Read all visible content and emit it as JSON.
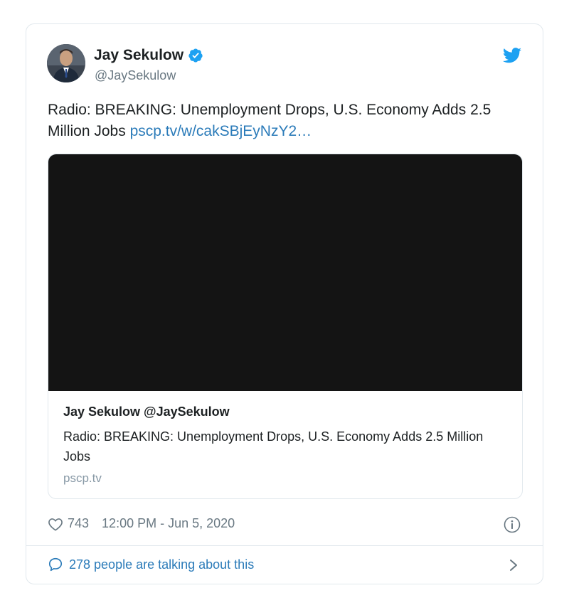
{
  "tweet": {
    "author_name": "Jay Sekulow",
    "author_handle": "@JaySekulow",
    "text": "Radio: BREAKING: Unemployment Drops, U.S. Economy Adds 2.5 Million Jobs",
    "link_text": "pscp.tv/w/cakSBjEyNzY2…",
    "card": {
      "title": "Jay Sekulow @JaySekulow",
      "description": "Radio: BREAKING: Unemployment Drops, U.S. Economy Adds 2.5 Million Jobs",
      "domain": "pscp.tv"
    },
    "likes": "743",
    "timestamp": "12:00 PM - Jun 5, 2020",
    "talking": "278 people are talking about this"
  },
  "icons": {
    "avatar": "avatar",
    "verified": "verified-badge-icon",
    "brand": "twitter-bird-icon",
    "like": "heart-icon",
    "info": "info-icon",
    "reply": "speech-bubble-icon",
    "more": "chevron-right-icon"
  },
  "colors": {
    "link": "#2b7bb9",
    "verified": "#1da1f2",
    "muted": "#697882",
    "border": "#e1e8ed",
    "media": "#141414"
  }
}
